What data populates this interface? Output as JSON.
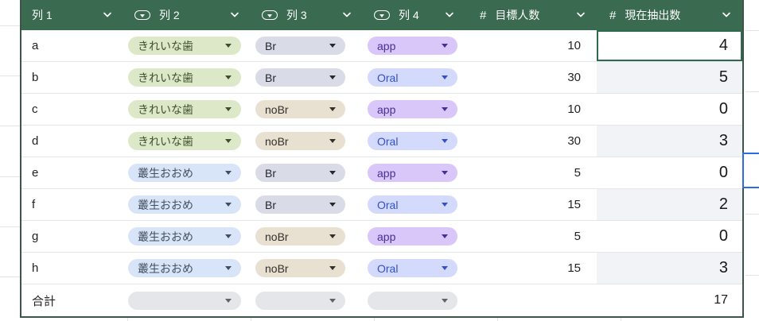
{
  "table": {
    "columns": [
      {
        "label": "列 1",
        "type": "text"
      },
      {
        "label": "列 2",
        "type": "dropdown"
      },
      {
        "label": "列 3",
        "type": "dropdown"
      },
      {
        "label": "列 4",
        "type": "dropdown"
      },
      {
        "label": "目標人数",
        "type": "number"
      },
      {
        "label": "現在抽出数",
        "type": "number"
      }
    ],
    "rows": [
      {
        "label": "a",
        "col2": {
          "text": "きれいな歯",
          "variant": "green"
        },
        "col3": {
          "text": "Br",
          "variant": "steel"
        },
        "col4": {
          "text": "app",
          "variant": "purple"
        },
        "target": "10",
        "current": "4"
      },
      {
        "label": "b",
        "col2": {
          "text": "きれいな歯",
          "variant": "green"
        },
        "col3": {
          "text": "Br",
          "variant": "steel"
        },
        "col4": {
          "text": "Oral",
          "variant": "indigo"
        },
        "target": "30",
        "current": "5"
      },
      {
        "label": "c",
        "col2": {
          "text": "きれいな歯",
          "variant": "green"
        },
        "col3": {
          "text": "noBr",
          "variant": "beige"
        },
        "col4": {
          "text": "app",
          "variant": "purple"
        },
        "target": "10",
        "current": "0"
      },
      {
        "label": "d",
        "col2": {
          "text": "きれいな歯",
          "variant": "green"
        },
        "col3": {
          "text": "noBr",
          "variant": "beige"
        },
        "col4": {
          "text": "Oral",
          "variant": "indigo"
        },
        "target": "30",
        "current": "3"
      },
      {
        "label": "e",
        "col2": {
          "text": "叢生おおめ",
          "variant": "sky"
        },
        "col3": {
          "text": "Br",
          "variant": "steel"
        },
        "col4": {
          "text": "app",
          "variant": "purple"
        },
        "target": "5",
        "current": "0"
      },
      {
        "label": "f",
        "col2": {
          "text": "叢生おおめ",
          "variant": "sky"
        },
        "col3": {
          "text": "Br",
          "variant": "steel"
        },
        "col4": {
          "text": "Oral",
          "variant": "indigo"
        },
        "target": "15",
        "current": "2"
      },
      {
        "label": "g",
        "col2": {
          "text": "叢生おおめ",
          "variant": "sky"
        },
        "col3": {
          "text": "noBr",
          "variant": "beige"
        },
        "col4": {
          "text": "app",
          "variant": "purple"
        },
        "target": "5",
        "current": "0"
      },
      {
        "label": "h",
        "col2": {
          "text": "叢生おおめ",
          "variant": "sky"
        },
        "col3": {
          "text": "noBr",
          "variant": "beige"
        },
        "col4": {
          "text": "Oral",
          "variant": "indigo"
        },
        "target": "15",
        "current": "3"
      }
    ],
    "footer": {
      "label": "合計",
      "col2": {
        "text": "",
        "variant": "gray"
      },
      "col3": {
        "text": "",
        "variant": "gray"
      },
      "col4": {
        "text": "",
        "variant": "gray"
      },
      "target": "",
      "total": "17"
    }
  },
  "icons": {
    "number_glyph": "#"
  },
  "colors": {
    "header_bg": "#3a6a50",
    "header_text": "#ffffff",
    "table_border": "#3e5349",
    "row_separator": "#e4e6e9",
    "alt_cell_bg": "#f1f3f6",
    "selected_cell_border": "#2e6b4d",
    "remote_cursor_blue": "#2b6de0",
    "chip_green_bg": "#dce8c8",
    "chip_sky_bg": "#d8e5f8",
    "chip_steel_bg": "#d9dbe7",
    "chip_beige_bg": "#e8e1d2",
    "chip_purple_bg": "#d8c7f8",
    "chip_indigo_bg": "#d3dafb",
    "chip_empty_bg": "#e5e6e9"
  }
}
